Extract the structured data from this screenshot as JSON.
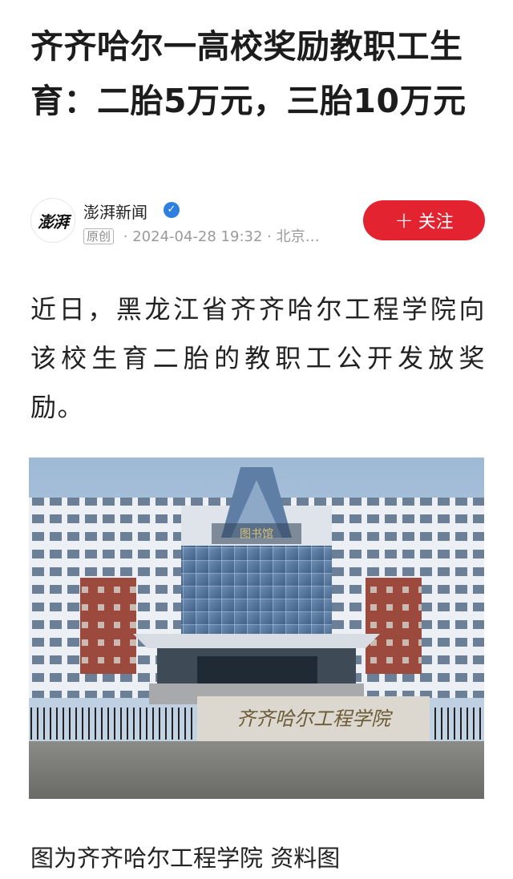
{
  "article": {
    "title": "齐齐哈尔一高校奖励教职工生育：二胎5万元，三胎10万元",
    "author": {
      "name": "澎湃新闻",
      "avatar_text": "澎湃",
      "verified_icon": "verified-check-icon",
      "original_badge": "原创",
      "timestamp": "2024-04-28 19:32",
      "location": "北京…",
      "separator": "·"
    },
    "follow": {
      "label": "关注",
      "icon": "plus-icon"
    },
    "body": "近日，黑龙江省齐齐哈尔工程学院向该校生育二胎的教职工公开发放奖励。",
    "image": {
      "sign_text": "齐齐哈尔工程学院",
      "roof_sign_text": "图书馆"
    },
    "caption": "图为齐齐哈尔工程学院 资料图"
  },
  "colors": {
    "accent_red": "#e3232f",
    "verified_blue": "#2f7fe0",
    "meta_gray": "#9a9a9a"
  }
}
